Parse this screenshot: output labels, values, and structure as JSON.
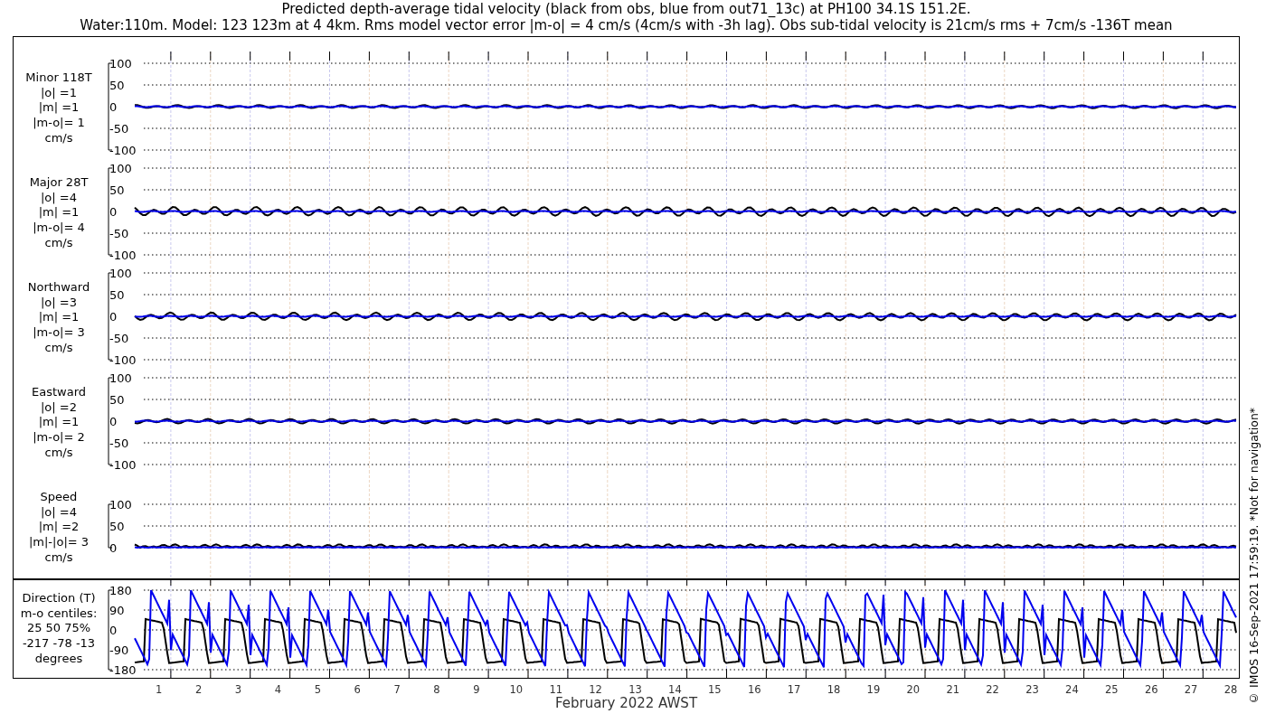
{
  "title": {
    "line_1": "Predicted depth-average tidal velocity (black from obs, blue from out71_13c) at PH100 34.1S 151.2E.",
    "line_2": "Water:110m. Model: 123 123m at 4 4km. Rms model vector error |m-o| = 4 cm/s (4cm/s with -3h lag). Obs sub-tidal velocity is 21cm/s rms + 7cm/s -136T mean"
  },
  "panels": [
    {
      "label_lines": [
        "Minor 118T",
        "|o| =1",
        "|m| =1",
        "|m-o|= 1",
        "cm/s"
      ],
      "yticks": [
        "100",
        "50",
        "0",
        "-50",
        "-100"
      ]
    },
    {
      "label_lines": [
        "Major 28T",
        "|o| =4",
        "|m| =1",
        "|m-o|= 4",
        "cm/s"
      ],
      "yticks": [
        "100",
        "50",
        "0",
        "-50",
        "-100"
      ]
    },
    {
      "label_lines": [
        "Northward",
        "|o| =3",
        "|m| =1",
        "|m-o|= 3",
        "cm/s"
      ],
      "yticks": [
        "100",
        "50",
        "0",
        "-50",
        "-100"
      ]
    },
    {
      "label_lines": [
        "Eastward",
        "|o| =2",
        "|m| =1",
        "|m-o|= 2",
        "cm/s"
      ],
      "yticks": [
        "100",
        "50",
        "0",
        "-50",
        "-100"
      ]
    },
    {
      "label_lines": [
        "Speed",
        "|o| =4",
        "|m| =2",
        "|m|-|o|= 3",
        "cm/s"
      ],
      "yticks": [
        "100",
        "50",
        "0"
      ]
    }
  ],
  "direction_panel": {
    "label_lines": [
      "Direction (T)",
      "m-o centiles:",
      "25  50  75%",
      "-217  -78  -13",
      "degrees"
    ],
    "yticks": [
      "180",
      "90",
      "0",
      "-90",
      "-180"
    ]
  },
  "x_axis": {
    "day_labels": [
      "1",
      "2",
      "3",
      "4",
      "5",
      "6",
      "7",
      "8",
      "9",
      "10",
      "11",
      "12",
      "13",
      "14",
      "15",
      "16",
      "17",
      "18",
      "19",
      "20",
      "21",
      "22",
      "23",
      "24",
      "25",
      "26",
      "27",
      "28"
    ],
    "xlabel": "February 2022 AWST"
  },
  "credit": "© IMOS 16-Sep-2021 17:59:19. *Not for navigation*"
}
